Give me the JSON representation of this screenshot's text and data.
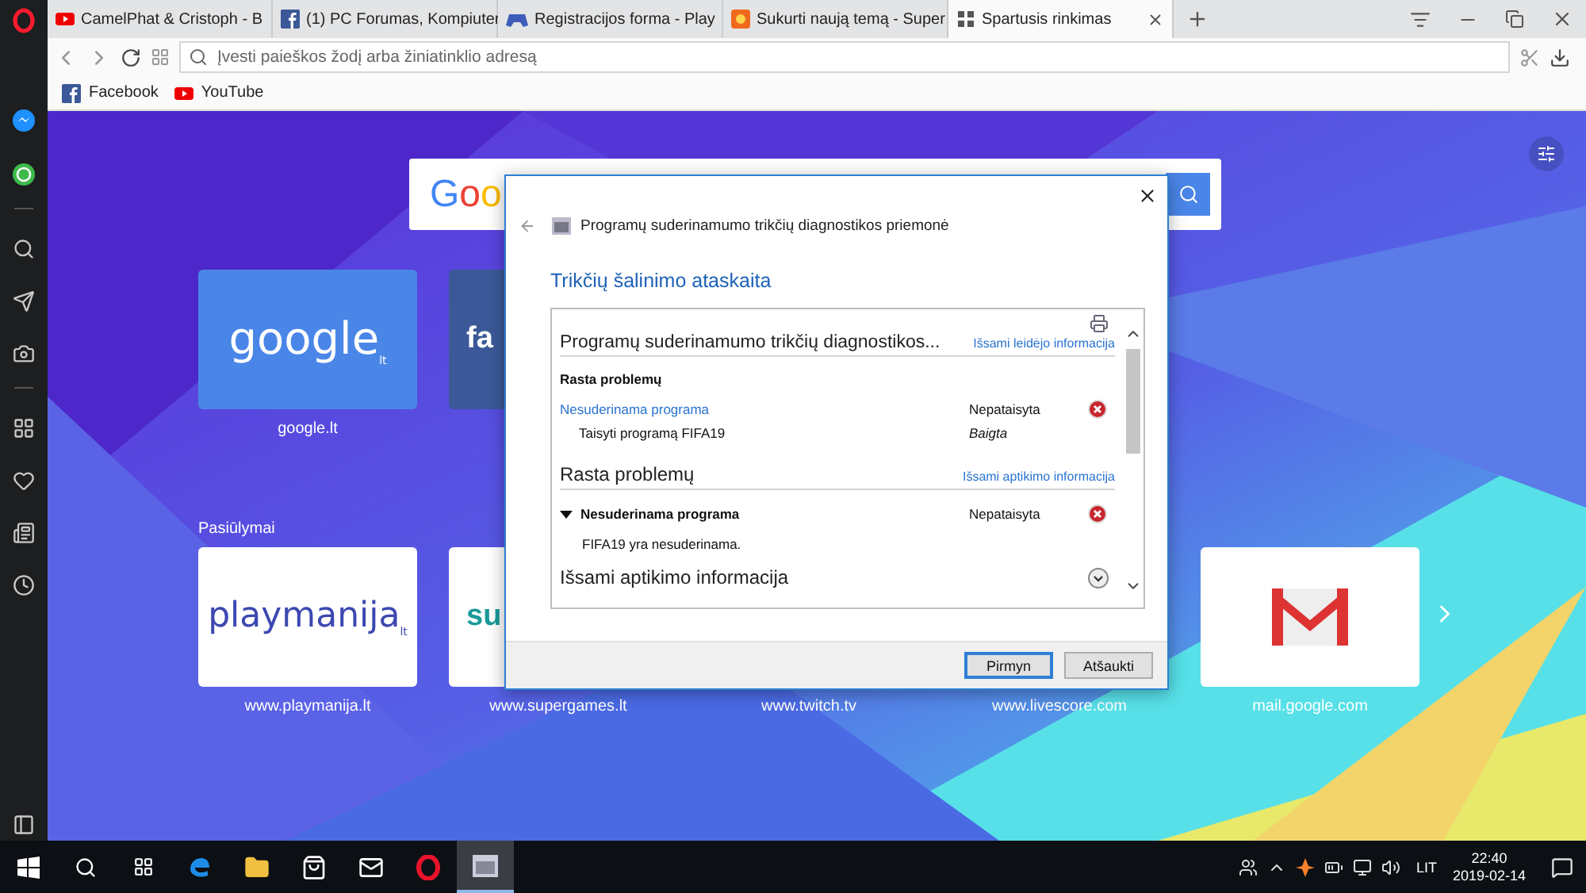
{
  "tabs": [
    {
      "title": "CamelPhat & Cristoph - B",
      "selected": false
    },
    {
      "title": "(1) PC Forumas, Kompiuter",
      "selected": false
    },
    {
      "title": "Registracijos forma - Play",
      "selected": false
    },
    {
      "title": "Sukurti naują temą - Super",
      "selected": false
    },
    {
      "title": "Spartusis rinkimas",
      "selected": true
    }
  ],
  "address_bar": {
    "placeholder": "Įvesti paieškos žodį arba žiniatinklio adresą"
  },
  "bookmarks": [
    "Facebook",
    "YouTube"
  ],
  "search_box": {
    "logo": "Goo"
  },
  "speed_dial": [
    {
      "kind": "text",
      "tile_text": "google",
      "tile_sub": "lt",
      "label": "google.lt"
    },
    {
      "kind": "text",
      "tile_text": "fa"
    }
  ],
  "suggestions": {
    "title": "Pasiūlymai",
    "items": [
      {
        "kind": "text",
        "tile_text": "playmanija",
        "tile_sub": "lt",
        "label": "www.playmanija.lt"
      },
      {
        "kind": "text",
        "tile_text": "su",
        "label": "www.supergames.lt"
      },
      {
        "kind": "covered",
        "label": "www.twitch.tv"
      },
      {
        "kind": "covered",
        "label": "www.livescore.com"
      },
      {
        "kind": "mail",
        "label": "mail.google.com"
      }
    ]
  },
  "dialog": {
    "title": "Programų suderinamumo trikčių diagnostikos priemonė",
    "heading": "Trikčių šalinimo ataskaita",
    "report": {
      "title": "Programų suderinamumo trikčių diagnostikos...",
      "title_link": "Išsami leidėjo informacija",
      "found_heading": "Rasta problemų",
      "problems": [
        {
          "name": "Nesuderinama programa",
          "status": "Nepataisyta",
          "fix": "Taisyti programą FIFA19",
          "fix_status": "Baigta"
        }
      ],
      "detection": {
        "title": "Rasta problemų",
        "link": "Išsami aptikimo informacija",
        "items": [
          {
            "name": "Nesuderinama programa",
            "status": "Nepataisyta",
            "description": "FIFA19 yra nesuderinama.",
            "expanded": true
          }
        ]
      },
      "details": {
        "title": "Išsami aptikimo informacija",
        "expanded": false
      }
    },
    "buttons": [
      {
        "label": "Pirmyn",
        "default": true
      },
      {
        "label": "Atšaukti",
        "default": false
      }
    ]
  },
  "taskbar": {
    "apps": [
      {
        "active": false
      },
      {
        "active": false
      },
      {
        "active": false
      },
      {
        "active": false
      },
      {
        "active": false
      },
      {
        "active": true
      }
    ],
    "language": "LIT",
    "time": "22:40",
    "date": "2019-02-14"
  }
}
